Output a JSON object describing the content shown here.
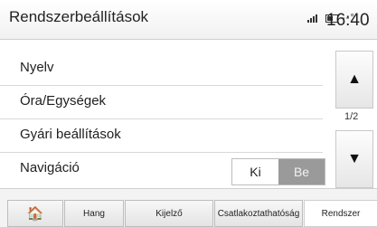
{
  "header": {
    "title": "Rendszerbeállítások",
    "temperature": "--°",
    "time": "16:40"
  },
  "menu": {
    "items": [
      "Nyelv",
      "Óra/Egységek",
      "Gyári beállítások",
      "Navigáció"
    ]
  },
  "navigation_toggle": {
    "off_label": "Ki",
    "on_label": "Be",
    "selected": "Be"
  },
  "scroll": {
    "up_symbol": "▲",
    "down_symbol": "▼",
    "page_indicator": "1/2"
  },
  "tabs": {
    "home_symbol": "🏠",
    "items": [
      "Hang",
      "Kijelző",
      "Csatlakoztathatóság",
      "Rendszer"
    ],
    "active": "Rendszer"
  }
}
